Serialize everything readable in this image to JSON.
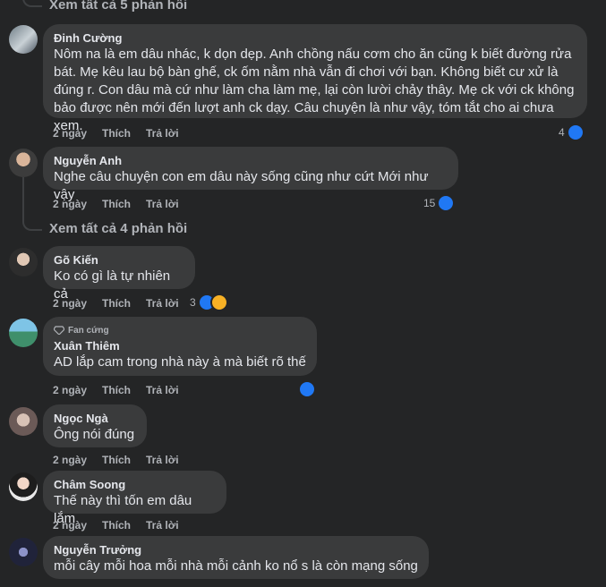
{
  "top_view_more": "Xem tất cả 5 phản hồi",
  "comments": [
    {
      "author": "Đinh Cường",
      "text": "Nôm na là em dâu nhác, k dọn dẹp. Anh chồng nấu cơm cho ăn cũng k biết đường rửa\nbát. Mẹ kêu lau bộ bàn ghế, ck ốm nằm nhà vẫn đi chơi với bạn. Không biết cư xử là\nđúng r. Con dâu mà cứ như làm cha làm mẹ, lại còn lười chảy thây. Mẹ ck với ck không\nbảo được nên mới đến lượt anh ck dạy. Câu chuyện là như vậy, tóm tắt cho ai chưa xem.",
      "time": "2 ngày",
      "like": "Thích",
      "reply": "Trả lời",
      "reaction_count": "4"
    },
    {
      "author": "Nguyễn Anh",
      "text": "Nghe câu chuyện con em dâu này sống cũng như cứt Mới như vậy",
      "time": "2 ngày",
      "like": "Thích",
      "reply": "Trả lời",
      "reaction_count": "15",
      "view_more": "Xem tất cả 4 phản hồi"
    },
    {
      "author": "Gõ Kiến",
      "text": "Ko có gì là tự nhiên cả",
      "time": "2 ngày",
      "like": "Thích",
      "reply": "Trả lời",
      "reaction_count": "3"
    },
    {
      "badge": "Fan cứng",
      "author": "Xuân Thiêm",
      "text": "AD lắp cam trong nhà này à mà biết rõ thế",
      "time": "2 ngày",
      "like": "Thích",
      "reply": "Trả lời"
    },
    {
      "author": "Ngọc Ngà",
      "text": "Ông nói đúng",
      "time": "2 ngày",
      "like": "Thích",
      "reply": "Trả lời"
    },
    {
      "author": "Châm Soong",
      "text": "Thế này thì tốn em dâu lắm",
      "time": "2 ngày",
      "like": "Thích",
      "reply": "Trả lời"
    },
    {
      "author": "Nguyễn Trưởng",
      "text": "mỗi cây mỗi hoa mỗi nhà mỗi cảnh ko nổ s là còn mạng sống"
    }
  ],
  "colors": {
    "background": "#242526",
    "bubble": "#3a3b3c",
    "text": "#e4e6eb",
    "secondary": "#b0b3b8",
    "like": "#2078f4",
    "sad": "#f7b125"
  },
  "icons": [
    "like-icon",
    "sad-icon",
    "diamond-icon"
  ]
}
